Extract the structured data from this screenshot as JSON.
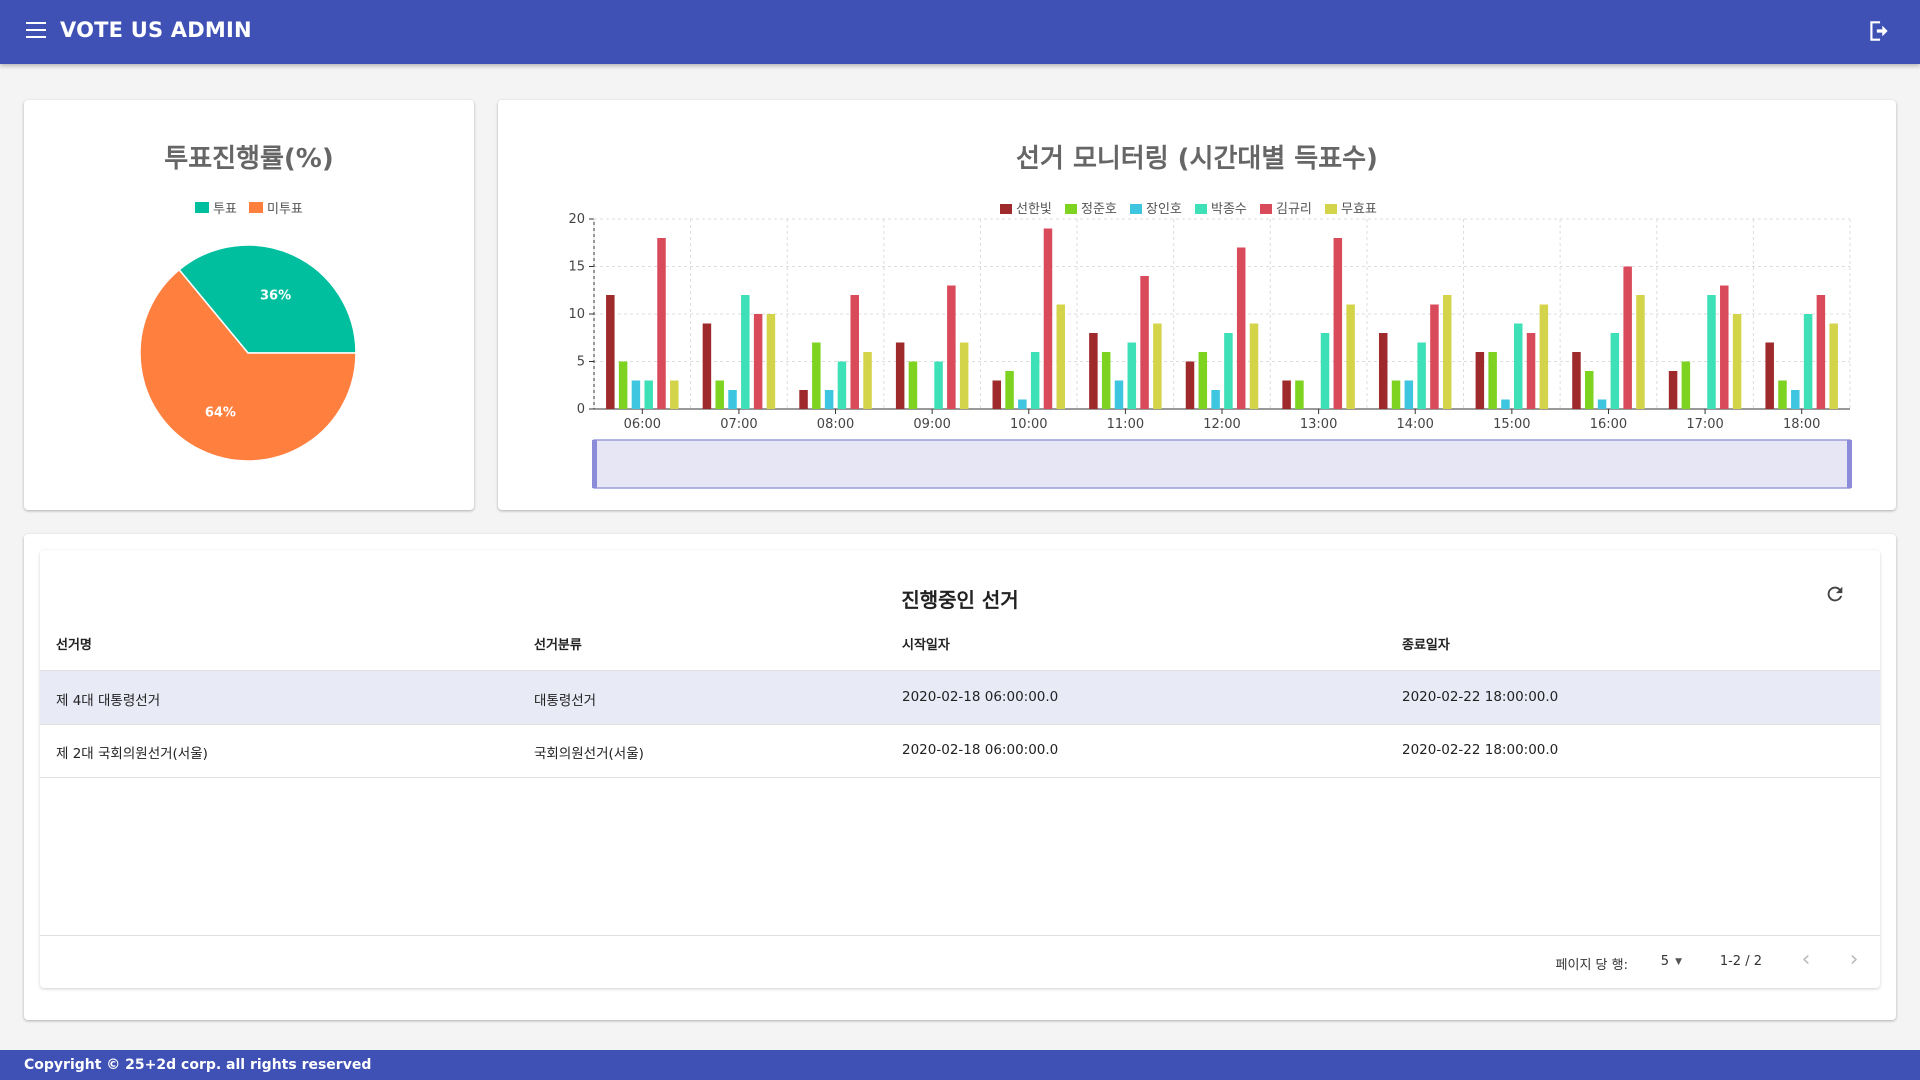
{
  "header": {
    "title": "VOTE US ADMIN",
    "menu_icon": "menu-icon",
    "logout_icon": "logout-icon"
  },
  "pie": {
    "title": "투표진행률(%)",
    "legend": [
      {
        "label": "투표",
        "color": "#00bf9f"
      },
      {
        "label": "미투표",
        "color": "#ff7f3f"
      }
    ]
  },
  "bar": {
    "title": "선거 모니터링 (시간대별 득표수)"
  },
  "chart_data": [
    {
      "type": "pie",
      "title": "투표진행률(%)",
      "categories": [
        "투표",
        "미투표"
      ],
      "values": [
        36,
        64
      ],
      "labels": [
        "36%",
        "64%"
      ],
      "colors": [
        "#00bf9f",
        "#ff7f3f"
      ],
      "legend": "top"
    },
    {
      "type": "bar",
      "title": "선거 모니터링 (시간대별 득표수)",
      "categories": [
        "06:00",
        "07:00",
        "08:00",
        "09:00",
        "10:00",
        "11:00",
        "12:00",
        "13:00",
        "14:00",
        "15:00",
        "16:00",
        "17:00",
        "18:00"
      ],
      "ylim": [
        0,
        20
      ],
      "yticks": [
        0,
        5,
        10,
        15,
        20
      ],
      "grid": true,
      "legend": "top",
      "series": [
        {
          "name": "선한빛",
          "color": "#9e2a2b",
          "values": [
            12,
            9,
            2,
            7,
            3,
            8,
            5,
            3,
            8,
            6,
            6,
            4,
            7
          ]
        },
        {
          "name": "정준호",
          "color": "#7ed321",
          "values": [
            5,
            3,
            7,
            5,
            4,
            6,
            6,
            3,
            3,
            6,
            4,
            5,
            3
          ]
        },
        {
          "name": "장인호",
          "color": "#3ec6e0",
          "values": [
            3,
            2,
            2,
            0,
            1,
            3,
            2,
            0,
            3,
            1,
            1,
            0,
            2
          ]
        },
        {
          "name": "박종수",
          "color": "#3ee0b8",
          "values": [
            3,
            12,
            5,
            5,
            6,
            7,
            8,
            8,
            7,
            9,
            8,
            12,
            10
          ]
        },
        {
          "name": "김규리",
          "color": "#d94a5b",
          "values": [
            18,
            10,
            12,
            13,
            19,
            14,
            17,
            18,
            11,
            8,
            15,
            13,
            12
          ]
        },
        {
          "name": "무효표",
          "color": "#d4d44a",
          "values": [
            3,
            10,
            6,
            7,
            11,
            9,
            9,
            11,
            12,
            11,
            12,
            10,
            9
          ]
        }
      ]
    }
  ],
  "table": {
    "title": "진행중인 선거",
    "columns": [
      "선거명",
      "선거분류",
      "시작일자",
      "종료일자"
    ],
    "rows": [
      {
        "name": "제 4대 대통령선거",
        "category": "대통령선거",
        "start": "2020-02-18 06:00:00.0",
        "end": "2020-02-22 18:00:00.0"
      },
      {
        "name": "제 2대 국회의원선거(서울)",
        "category": "국회의원선거(서울)",
        "start": "2020-02-18 06:00:00.0",
        "end": "2020-02-22 18:00:00.0"
      }
    ],
    "pager": {
      "rows_per_page_label": "페이지 당 행:",
      "rows_per_page": "5",
      "range": "1-2 / 2"
    }
  },
  "footer": {
    "copyright": "Copyright © 25+2d corp. all rights reserved"
  }
}
